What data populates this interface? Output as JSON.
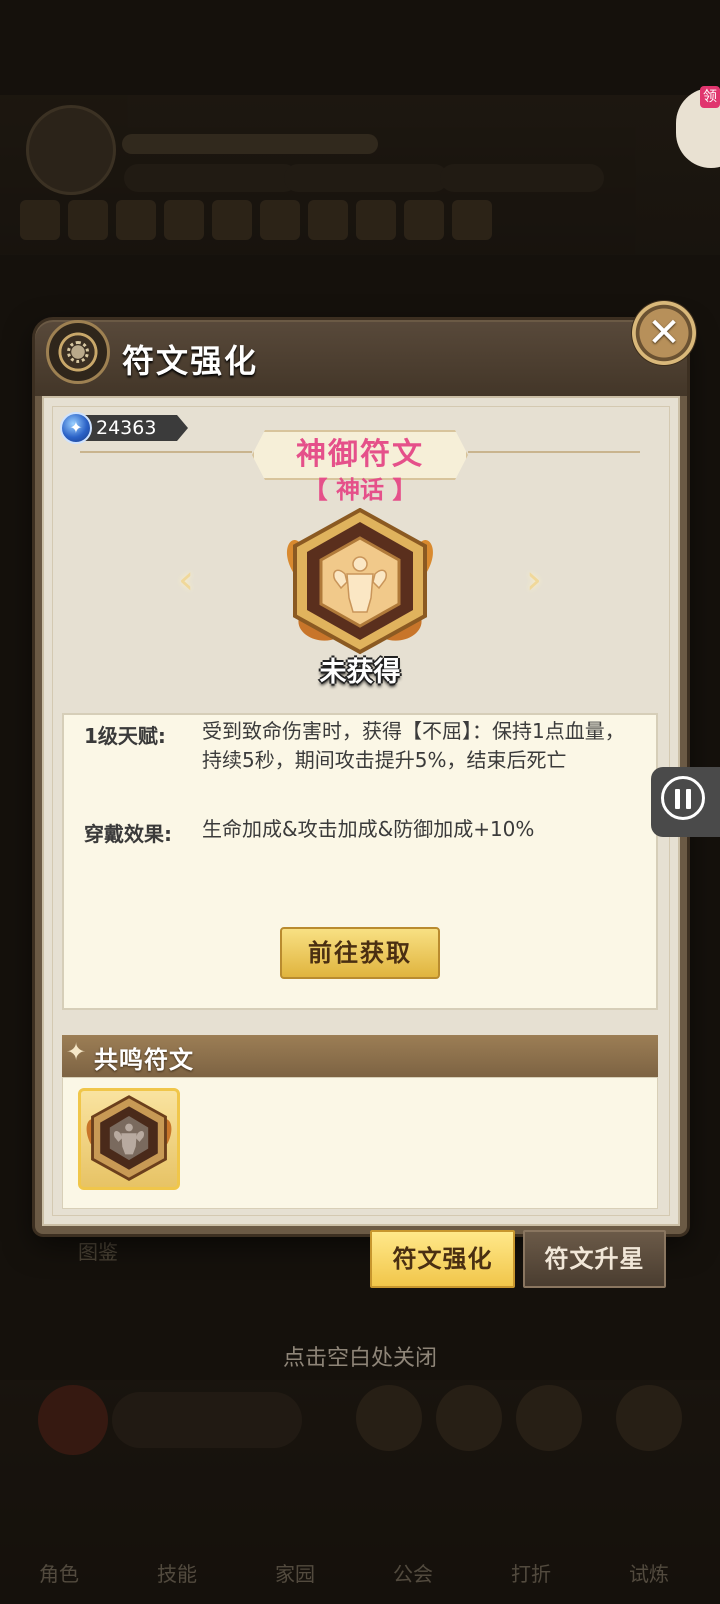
{
  "background": {
    "player_name": "",
    "exp_text": "",
    "level": "",
    "resources": [
      "",
      "",
      ""
    ],
    "close_hint": "点击空白处关闭",
    "nav_items": [
      "角色",
      "技能",
      "家园",
      "公会",
      "打折",
      "试炼"
    ],
    "gift_label": "领"
  },
  "modal": {
    "title": "符文强化",
    "close_icon": "close-icon",
    "currency": {
      "icon": "blue-gem-icon",
      "value": "24363"
    },
    "rune": {
      "name": "神御符文",
      "rarity": "【 神话 】",
      "status": "未获得",
      "icon": "muscle-hexagon-rune-icon"
    },
    "info": {
      "talent_label": "1级天赋:",
      "talent_text": "受到致命伤害时，获得【不屈】：保持1点血量，持续5秒，期间攻击提升5%，结束后死亡",
      "wear_label": "穿戴效果:",
      "wear_text": "生命加成&攻击加成&防御加成+10%",
      "goto_button": "前往获取"
    },
    "resonance": {
      "title": "共鸣符文",
      "slot_icon": "muscle-hexagon-rune-icon"
    },
    "tabs": [
      {
        "label": "符文强化",
        "active": true
      },
      {
        "label": "符文升星",
        "active": false
      }
    ]
  },
  "colors": {
    "rune_name": "#e5508a",
    "panel_frame": "#6b5a45",
    "gold_button": "#f1c64a"
  }
}
